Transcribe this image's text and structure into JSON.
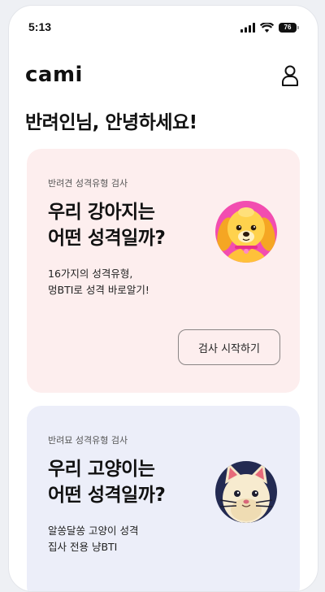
{
  "status_bar": {
    "time": "5:13",
    "battery_level": "76"
  },
  "header": {
    "logo": "cami",
    "profile_icon": "person-icon"
  },
  "greeting": "반려인님, 안녕하세요!",
  "dog_card": {
    "label": "반려견 성격유형 검사",
    "title_line1": "우리 강아지는",
    "title_line2": "어떤 성격일까?",
    "desc_line1": "16가지의 성격유형,",
    "desc_line2": "멍BTI로 성격 바로알기!",
    "button_label": "검사 시작하기",
    "image": "dog-illustration",
    "background": "#fdeeee"
  },
  "cat_card": {
    "label": "반려묘 성격유형 검사",
    "title_line1": "우리 고양이는",
    "title_line2": "어떤 성격일까?",
    "desc_line1": "알쏭달쏭 고양이 성격",
    "desc_line2": "집사 전용 냥BTI",
    "image": "cat-illustration",
    "background": "#eceef9"
  }
}
